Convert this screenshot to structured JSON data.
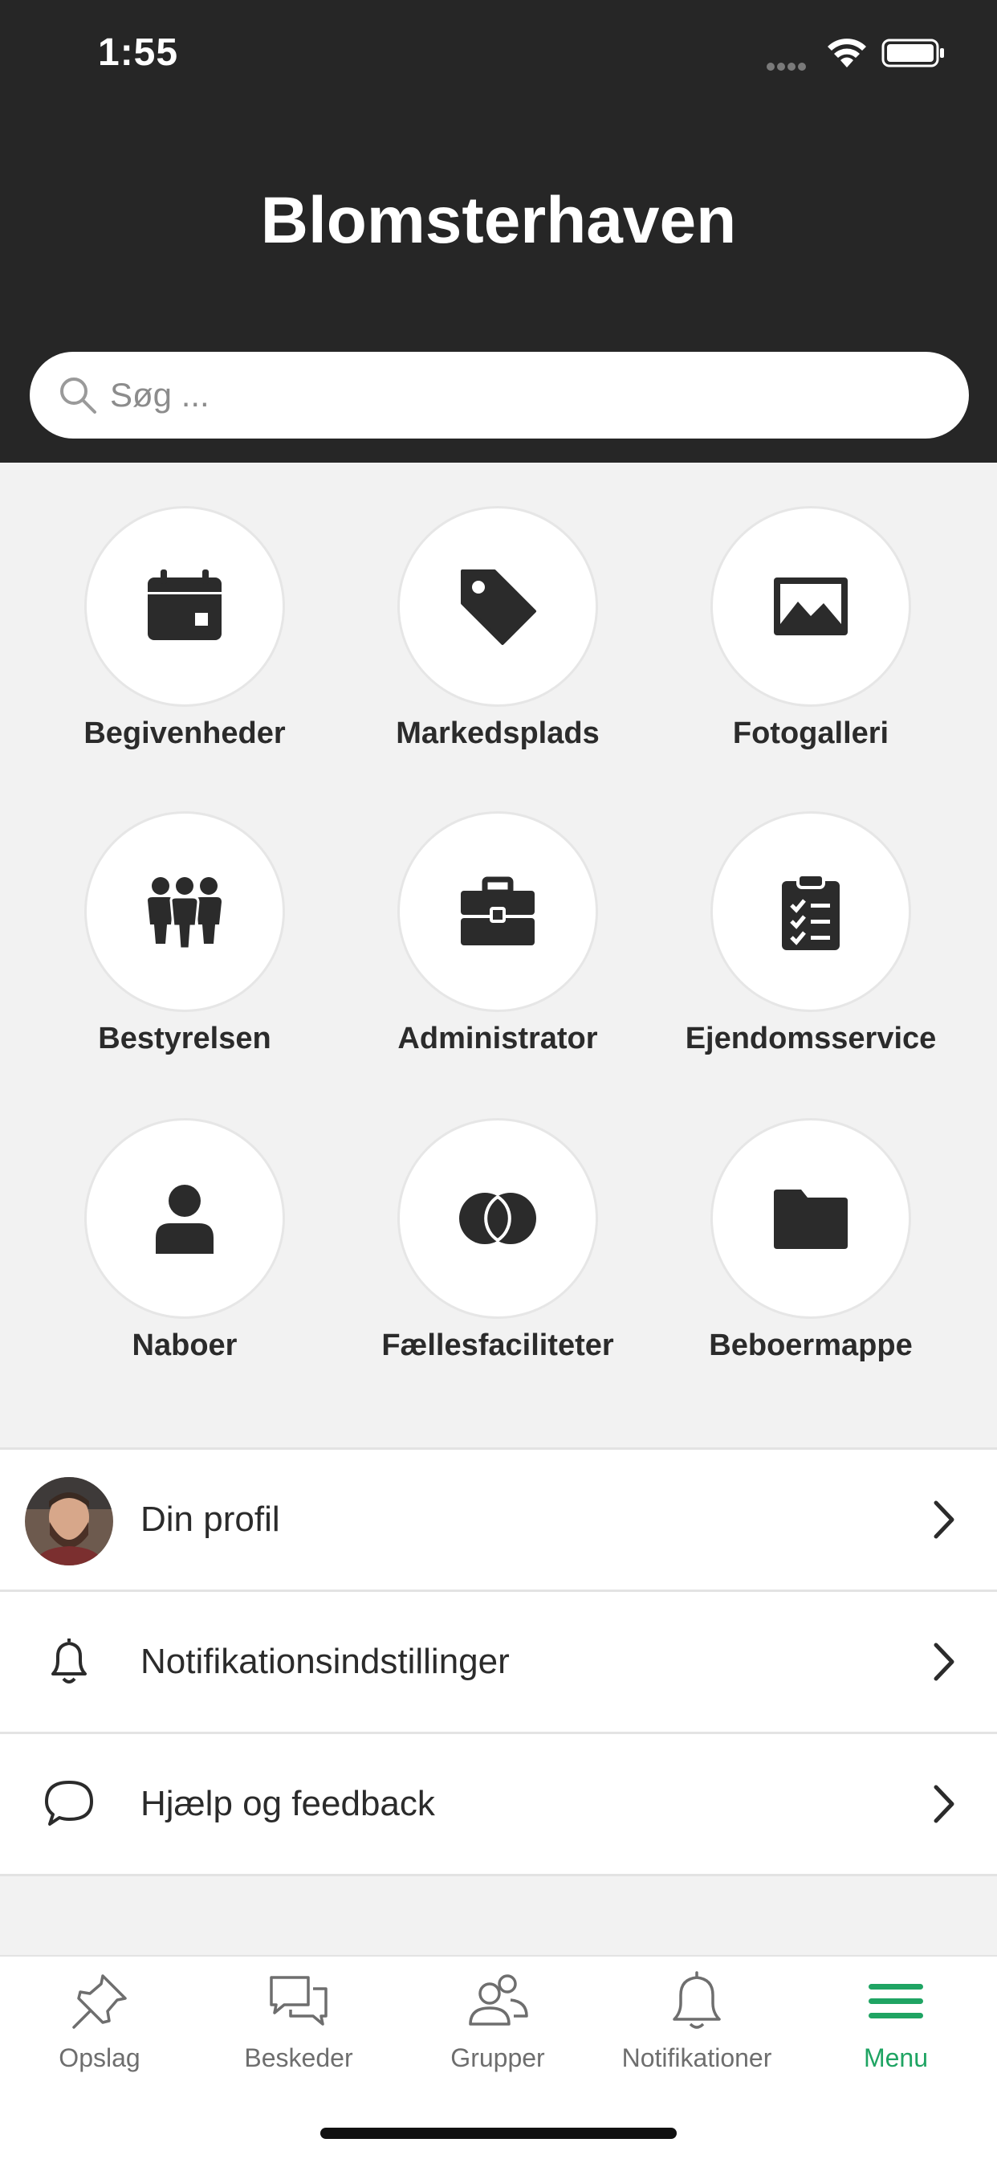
{
  "status_bar": {
    "time": "1:55"
  },
  "header": {
    "title": "Blomsterhaven"
  },
  "search": {
    "placeholder": "Søg ..."
  },
  "tiles": [
    {
      "label": "Begivenheder",
      "icon": "calendar-icon"
    },
    {
      "label": "Markedsplads",
      "icon": "tag-icon"
    },
    {
      "label": "Fotogalleri",
      "icon": "image-icon"
    },
    {
      "label": "Bestyrelsen",
      "icon": "people-group-icon"
    },
    {
      "label": "Administrator",
      "icon": "briefcase-icon"
    },
    {
      "label": "Ejendomsservice",
      "icon": "clipboard-check-icon"
    },
    {
      "label": "Naboer",
      "icon": "person-icon"
    },
    {
      "label": "Fællesfaciliteter",
      "icon": "overlapping-circles-icon"
    },
    {
      "label": "Beboermappe",
      "icon": "folder-icon"
    }
  ],
  "list": [
    {
      "label": "Din profil",
      "icon": "avatar"
    },
    {
      "label": "Notifikationsindstillinger",
      "icon": "bell-icon"
    },
    {
      "label": "Hjælp og feedback",
      "icon": "speech-bubble-icon"
    }
  ],
  "tabbar": {
    "tabs": [
      {
        "label": "Opslag",
        "icon": "pin-icon"
      },
      {
        "label": "Beskeder",
        "icon": "chat-icon"
      },
      {
        "label": "Grupper",
        "icon": "group-icon"
      },
      {
        "label": "Notifikationer",
        "icon": "bell-icon"
      },
      {
        "label": "Menu",
        "icon": "hamburger-icon"
      }
    ],
    "active": "Menu"
  },
  "colors": {
    "header_bg": "#262626",
    "content_bg": "#f2f2f2",
    "icon_dark": "#2b2b2b",
    "accent_green": "#1fa463",
    "tab_inactive": "#6e6e6e"
  }
}
